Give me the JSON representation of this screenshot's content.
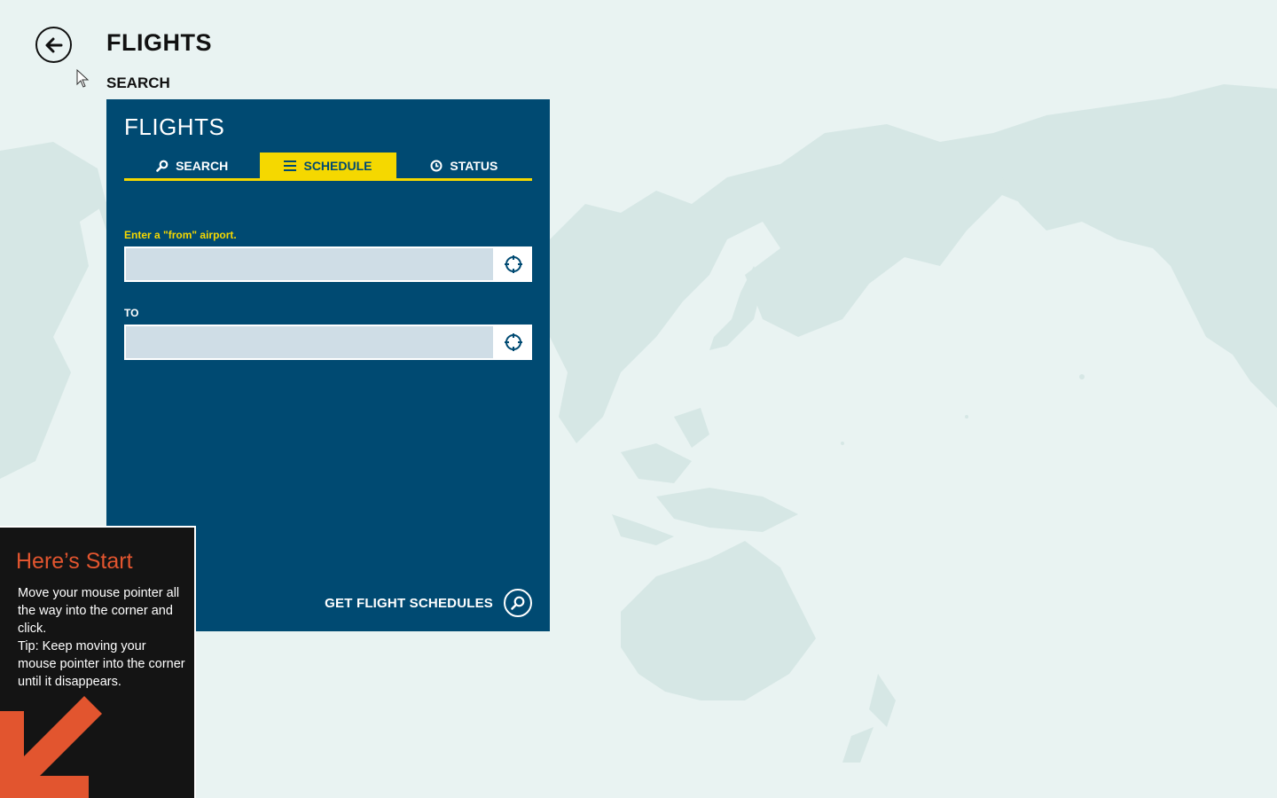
{
  "header": {
    "title": "FLIGHTS",
    "section": "SEARCH"
  },
  "panel": {
    "title": "FLIGHTS",
    "tabs": [
      {
        "label": "SEARCH",
        "icon": "search-icon",
        "active": false
      },
      {
        "label": "SCHEDULE",
        "icon": "list-icon",
        "active": true
      },
      {
        "label": "STATUS",
        "icon": "clock-icon",
        "active": false
      }
    ],
    "from_label": "Enter a \"from\" airport.",
    "from_value": "",
    "to_label": "TO",
    "to_value": "",
    "submit_label": "GET FLIGHT SCHEDULES"
  },
  "start_tip": {
    "title": "Here’s Start",
    "line1": "Move your mouse pointer all the way into the corner and click.",
    "line2": "Tip: Keep moving your mouse pointer into the corner until it disappears."
  },
  "colors": {
    "background": "#e9f3f2",
    "map_land": "#d6e7e5",
    "panel": "#004a72",
    "accent": "#f5d800",
    "start_title": "#e2552f",
    "start_arrow": "#e2552f"
  }
}
